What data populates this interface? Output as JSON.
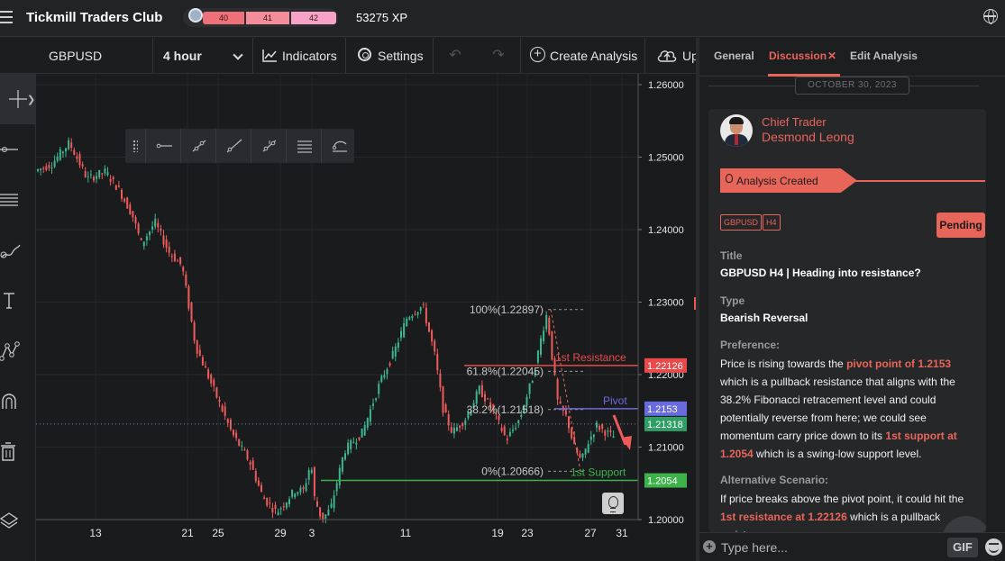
{
  "app": {
    "title": "Tickmill Traders Club",
    "xp": {
      "segments": [
        "40",
        "41",
        "42"
      ],
      "value": "53275 XP"
    }
  },
  "toolbar": {
    "symbol": "GBPUSD",
    "interval": "4 hour",
    "indicators_label": "Indicators",
    "settings_label": "Settings",
    "create_label": "Create Analysis",
    "upload_label": "Upload"
  },
  "left_tools": [
    "crosshair-icon",
    "horizontal-line-icon",
    "fibonacci-icon",
    "brush-icon",
    "text-icon",
    "pattern-icon",
    "magnet-icon",
    "trash-icon",
    "layers-icon"
  ],
  "chart_data": {
    "type": "candlestick",
    "symbol": "GBPUSD",
    "timeframe": "H4",
    "y_ticks": [
      "1.26000",
      "1.25000",
      "1.24000",
      "1.23000",
      "1.22000",
      "1.21000",
      "1.20000"
    ],
    "ylim": [
      1.2,
      1.26
    ],
    "x_ticks": [
      "13",
      "21",
      "25",
      "29",
      "3",
      "11",
      "19",
      "23",
      "27",
      "31"
    ],
    "current_price": "1.21318",
    "fibonacci": [
      {
        "label": "100%(1.22897)",
        "value": 1.22897
      },
      {
        "label": "61.8%(1.22045)",
        "value": 1.22045
      },
      {
        "label": "38.2%(1.21518)",
        "value": 1.21518
      },
      {
        "label": "0%(1.20666)",
        "value": 1.20666
      }
    ],
    "levels": [
      {
        "name": "1st Resistance",
        "value": "1.22126",
        "color": "#e84a4a"
      },
      {
        "name": "Pivot",
        "value": "1.2153",
        "color": "#6a6adf"
      },
      {
        "name": "1st Support",
        "value": "1.2054",
        "color": "#3db14a"
      }
    ],
    "colors": {
      "up": "#3db58e",
      "down": "#ef5b5b"
    }
  },
  "panel": {
    "tabs": [
      "General",
      "Discussion",
      "Edit Analysis"
    ],
    "date": "OCTOBER 30, 2023",
    "author": {
      "role": "Chief Trader",
      "name": "Desmond Leong"
    },
    "created_label": "Analysis Created",
    "badges": [
      "GBPUSD",
      "H4"
    ],
    "status": "Pending",
    "title_label": "Title",
    "title_value": "GBPUSD H4 | Heading into resistance?",
    "type_label": "Type",
    "type_value": "Bearish Reversal",
    "preference_label": "Preference:",
    "preference": {
      "t1": "Price is rising towards the ",
      "h1": "pivot point of 1.2153",
      "t2": " which is a pullback resistance that aligns with the 38.2% Fibonacci retracement level and could potentially reverse from here; we could see momentum carry price down to its ",
      "h2": "1st support at 1.2054",
      "t3": " which is a swing-low support level."
    },
    "alt_label": "Alternative Scenario:",
    "alternative": {
      "t1": "If price breaks above the pivot point, it could hit the ",
      "h1": "1st resistance at 1.22126",
      "t2": " which is a pullback resistance"
    },
    "composer_placeholder": "Type here...",
    "gif_label": "GIF"
  }
}
